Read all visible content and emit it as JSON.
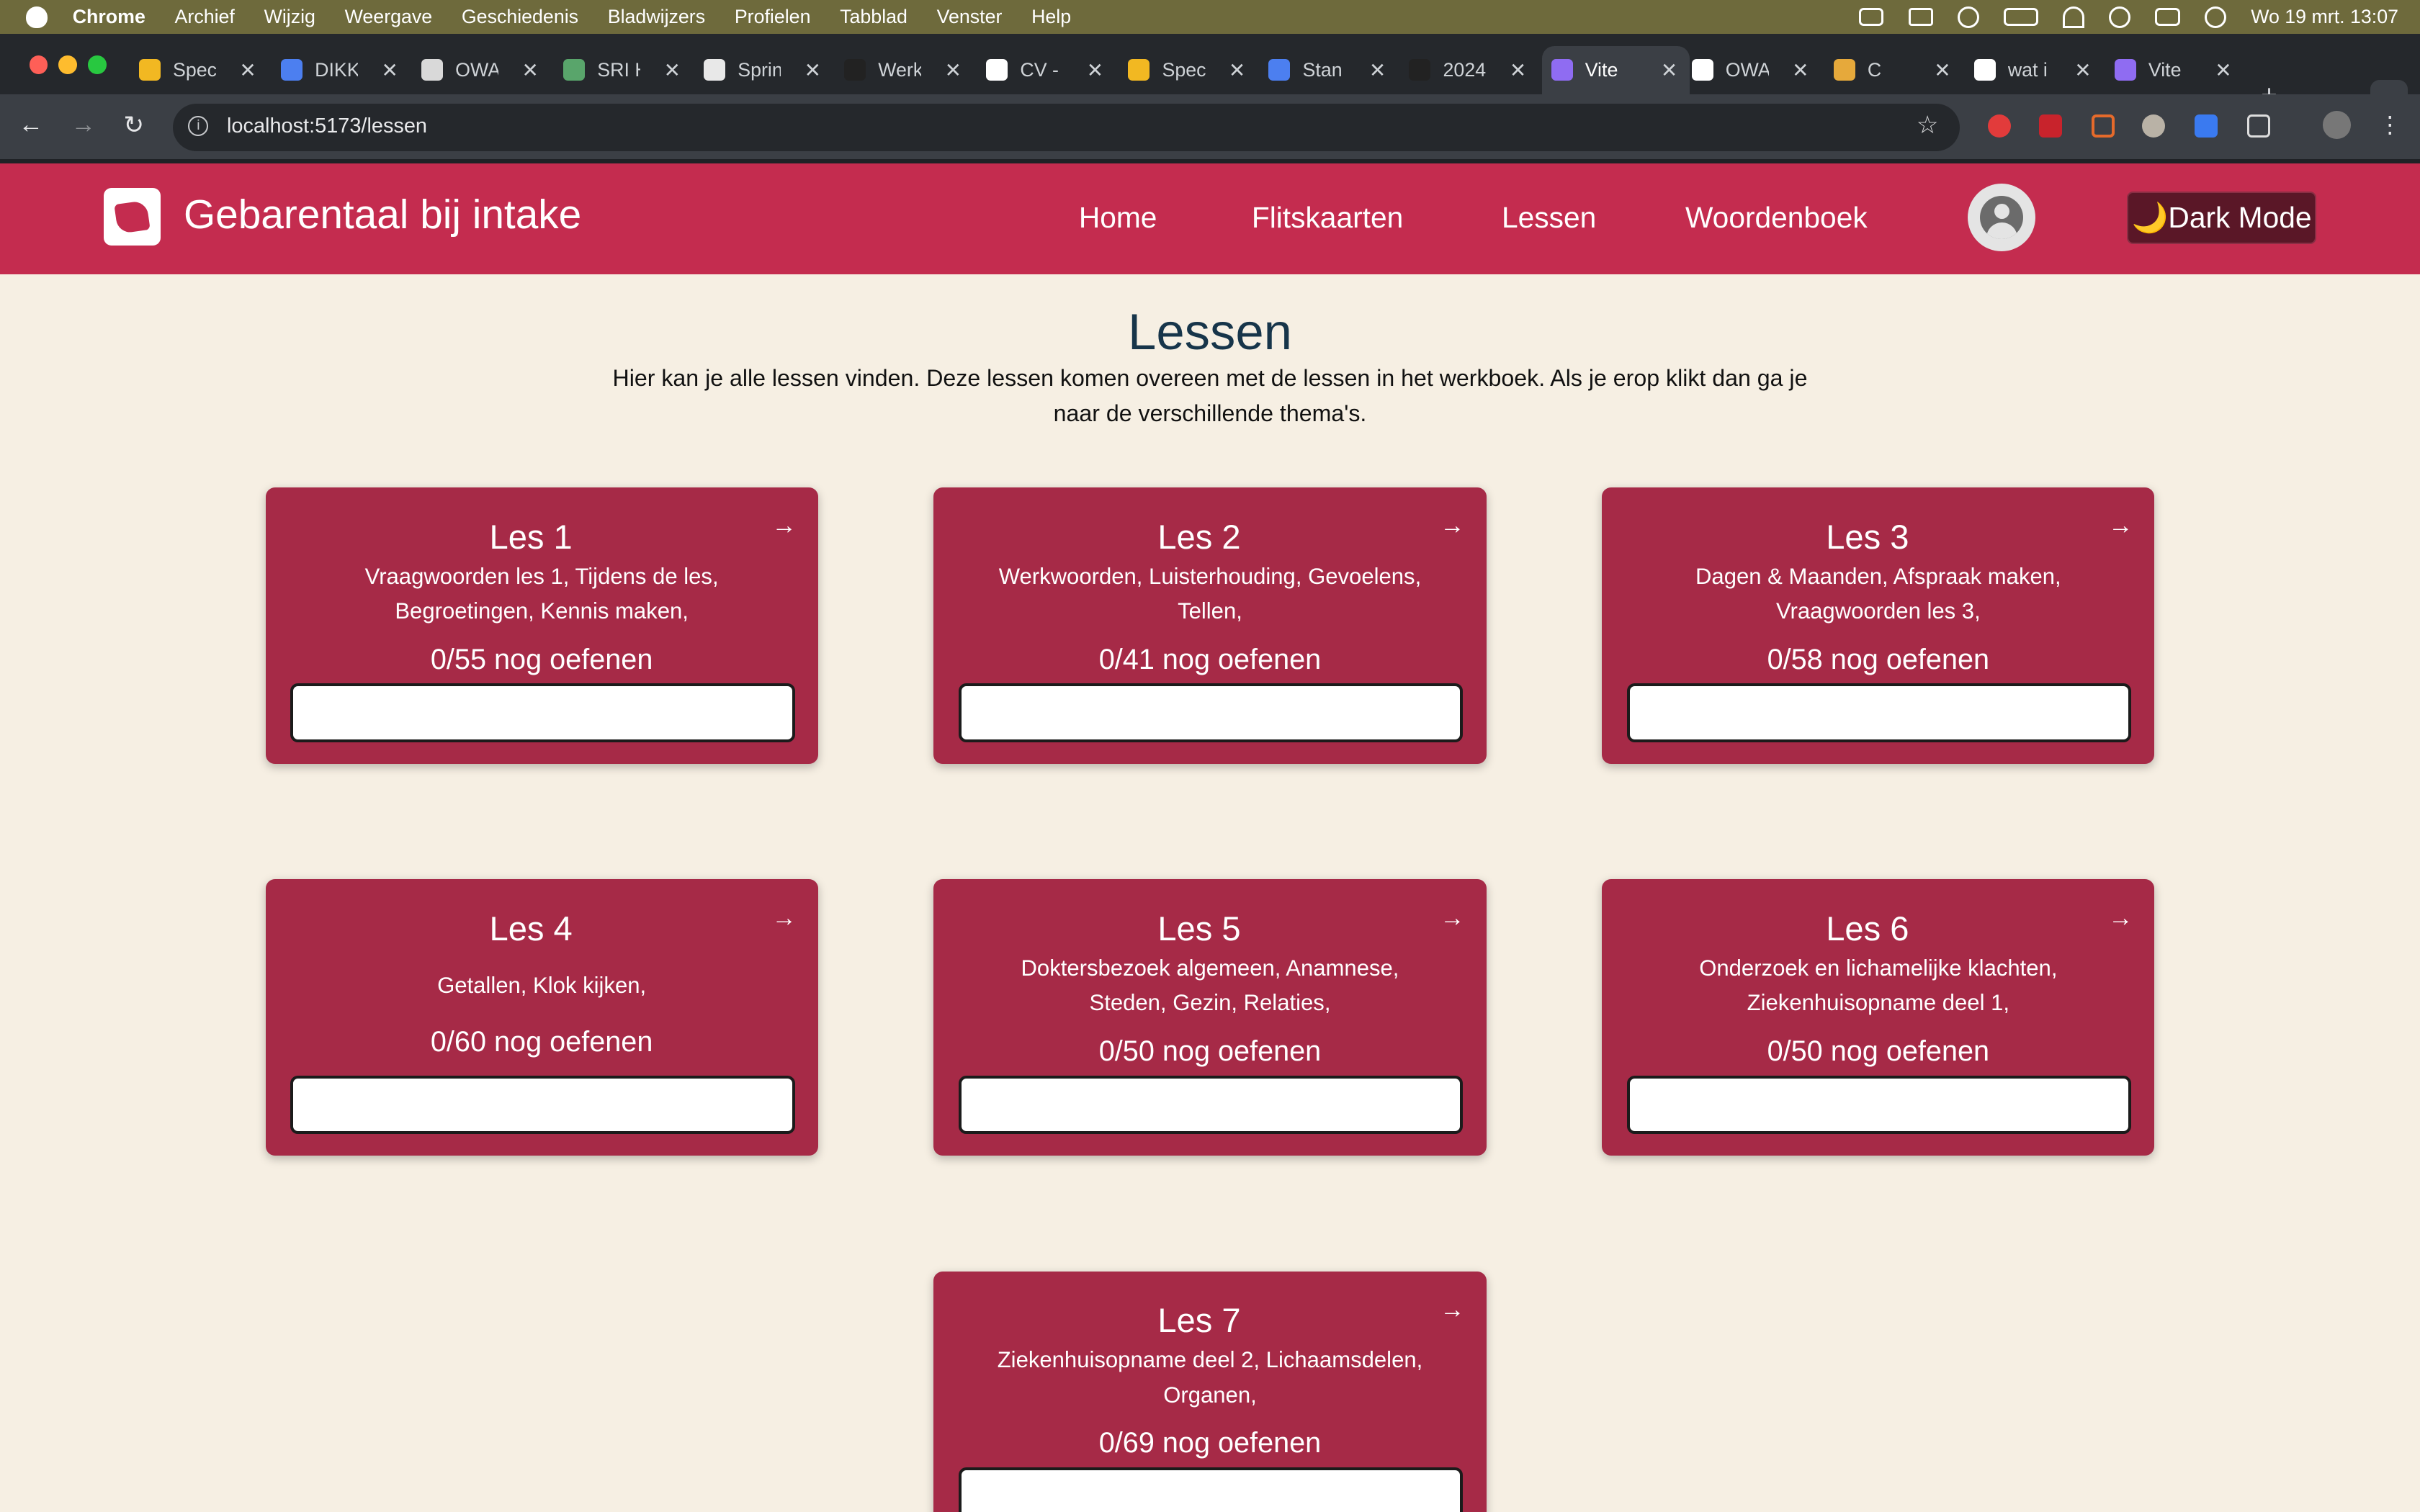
{
  "menubar": {
    "items": [
      "Chrome",
      "Archief",
      "Wijzig",
      "Weergave",
      "Geschiedenis",
      "Bladwijzers",
      "Profielen",
      "Tabblad",
      "Venster",
      "Help"
    ],
    "clock": "Wo 19 mrt. 13:07"
  },
  "tabs": [
    {
      "label": "Spec",
      "fav": "#f2b822"
    },
    {
      "label": "DIKK",
      "fav": "#4c7ff0"
    },
    {
      "label": "OWA",
      "fav": "#d9d9d9"
    },
    {
      "label": "SRI H",
      "fav": "#59a56b"
    },
    {
      "label": "Sprin",
      "fav": "#e8e8e8"
    },
    {
      "label": "Werk",
      "fav": "#222222"
    },
    {
      "label": "CV -",
      "fav": "#ffffff"
    },
    {
      "label": "Spec",
      "fav": "#f2b822"
    },
    {
      "label": "Stan",
      "fav": "#4c7ff0"
    },
    {
      "label": "2024",
      "fav": "#222222"
    },
    {
      "label": "Vite",
      "fav": "#8f6cf2"
    },
    {
      "label": "OWA",
      "fav": "#ffffff"
    },
    {
      "label": "C",
      "fav": "#e6a93b"
    },
    {
      "label": "wat i",
      "fav": "#ffffff"
    },
    {
      "label": "Vite",
      "fav": "#8f6cf2"
    }
  ],
  "browser": {
    "url": "localhost:5173/lessen",
    "new_tab": "+",
    "tab_menu": "⌄"
  },
  "site": {
    "brand": "Gebarentaal bij intake",
    "nav": [
      "Home",
      "Flitskaarten",
      "Lessen",
      "Woordenboek"
    ],
    "dark_mode": "🌙Dark Mode"
  },
  "main": {
    "title": "Lessen",
    "intro": "Hier kan je alle lessen vinden. Deze lessen komen overeen met de lessen in het werkboek. Als je erop klikt dan ga je naar de verschillende thema's."
  },
  "lessons": [
    {
      "title": "Les 1",
      "topics": "Vraagwoorden les 1, Tijdens de les, Begroetingen, Kennis maken,",
      "progress": "0/55 nog oefenen",
      "done": 0,
      "total": 55
    },
    {
      "title": "Les 2",
      "topics": "Werkwoorden, Luisterhouding, Gevoelens, Tellen,",
      "progress": "0/41 nog oefenen",
      "done": 0,
      "total": 41
    },
    {
      "title": "Les 3",
      "topics": "Dagen & Maanden, Afspraak maken, Vraagwoorden les 3,",
      "progress": "0/58 nog oefenen",
      "done": 0,
      "total": 58
    },
    {
      "title": "Les 4",
      "topics": "Getallen, Klok kijken,",
      "progress": "0/60 nog oefenen",
      "done": 0,
      "total": 60
    },
    {
      "title": "Les 5",
      "topics": "Doktersbezoek algemeen, Anamnese, Steden, Gezin, Relaties,",
      "progress": "0/50 nog oefenen",
      "done": 0,
      "total": 50
    },
    {
      "title": "Les 6",
      "topics": "Onderzoek en lichamelijke klachten, Ziekenhuisopname deel 1,",
      "progress": "0/50 nog oefenen",
      "done": 0,
      "total": 50
    },
    {
      "title": "Les 7",
      "topics": "Ziekenhuisopname deel 2, Lichaamsdelen, Organen,",
      "progress": "0/69 nog oefenen",
      "done": 0,
      "total": 69
    }
  ],
  "arrow_glyph": "→"
}
